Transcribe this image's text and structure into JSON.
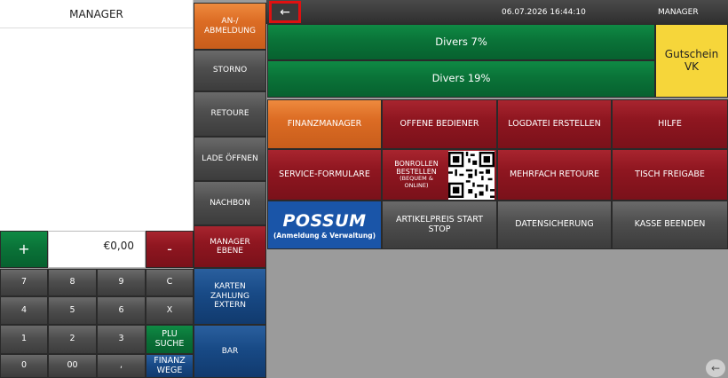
{
  "receipt": {
    "title": "MANAGER"
  },
  "amount": {
    "value": "€0,00"
  },
  "keypad": {
    "plus": "+",
    "minus": "-",
    "k7": "7",
    "k8": "8",
    "k9": "9",
    "clear": "C",
    "k4": "4",
    "k5": "5",
    "k6": "6",
    "x": "X",
    "k1": "1",
    "k2": "2",
    "k3": "3",
    "plu": "PLU SUCHE",
    "k0": "0",
    "k00": "00",
    "comma": ",",
    "finanz": "FINANZ WEGE"
  },
  "middle": {
    "login": "AN-/ ABMELDUNG",
    "storno": "STORNO",
    "retoure": "RETOURE",
    "lade": "LADE ÖFFNEN",
    "nachbon": "NACHBON",
    "manager": "MANAGER EBENE",
    "karten": "KARTEN ZAHLUNG EXTERN",
    "bar": "BAR"
  },
  "topbar": {
    "datetime": "06.07.2026 16:44:10",
    "user": "MANAGER",
    "back_icon": "←"
  },
  "articles": {
    "divers7": "Divers 7%",
    "divers19": "Divers 19%",
    "gutschein": "Gutschein VK"
  },
  "grid": {
    "finanzmanager": "FINANZMANAGER",
    "offene": "OFFENE BEDIENER",
    "logdatei": "LOGDATEI ERSTELLEN",
    "hilfe": "HILFE",
    "service": "SERVICE-FORMULARE",
    "bonrollen": "BONROLLEN BESTELLEN",
    "bonrollen_sub": "(BEQUEM & ONLINE)",
    "mehrfach": "MEHRFACH RETOURE",
    "tisch": "TISCH FREIGABE",
    "possum_logo": "POSSUM",
    "possum_sub": "(Anmeldung & Verwaltung)",
    "artikelpreis": "ARTIKELPREIS START STOP",
    "datensicherung": "DATENSICHERUNG",
    "kasse": "KASSE BEENDEN"
  },
  "footer": {
    "arrow_icon": "←"
  },
  "colors": {
    "accent_green": "#0a7338",
    "accent_red": "#8f1620",
    "accent_orange": "#dc6c24",
    "accent_blue": "#184a86",
    "yellow": "#f6d63a"
  }
}
